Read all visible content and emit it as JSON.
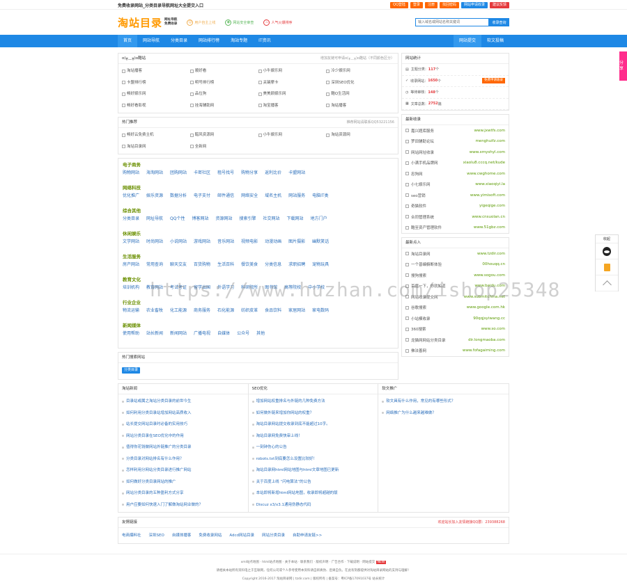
{
  "topbar": {
    "slogan": "免费收录网站_分类目录导航网址大全提交入口",
    "buttons": [
      "QQ登陆",
      "登录",
      "注册",
      "找回密码",
      "网站申请收录",
      "建议反馈"
    ]
  },
  "header": {
    "logo": "淘站目录",
    "logo_sub1": "网址导航",
    "logo_sub2": "免费收录",
    "features": [
      "用户自主上线",
      "网站安全审查",
      "人气火爆排序"
    ],
    "search_placeholder": "输入域名或网站名称关键词",
    "search_button": "收录查询"
  },
  "nav": {
    "items": [
      "首页",
      "网站导航",
      "分类目录",
      "网站排行榜",
      "淘站专题",
      "IT资讯"
    ],
    "right": [
      "网站提交",
      "软文投稿"
    ]
  },
  "recommend": {
    "title": "o(╥﹏╥)o酷站",
    "tip": "增加友链可申请o(╥﹏╥)o酷站（不同颜色区分）",
    "sites": [
      "淘站播客",
      "顺好看",
      "小牛娱乐网",
      "冷少娱乐网",
      "卡盟排行榜",
      "明号排行榜",
      "关键摩卡",
      "深圳SEO优化",
      "畅好娱乐网",
      "品位狗",
      "美美颜娱乐网",
      "酷Q生活网",
      "畅好看影视",
      "挂海辅助网",
      "淘宝播客",
      "淘站播客"
    ]
  },
  "hot": {
    "title": "热门推荐",
    "tip": "推荐网站请联系QQ53221156",
    "sites": [
      "畅好云免费主机",
      "醋风资源网",
      "小牛娱乐网",
      "淘站资源网",
      "淘站目录网",
      "全新网"
    ]
  },
  "categories": [
    {
      "name": "电子商务",
      "links": [
        "购物网站",
        "海淘网站",
        "团购网站",
        "卡密社区",
        "租号找号",
        "购物分享",
        "返利比价",
        "卡盟网站"
      ]
    },
    {
      "name": "网络科技",
      "links": [
        "优化推广",
        "娱乐资源",
        "数据分析",
        "电子支付",
        "邮件通信",
        "网络安全",
        "域名主机",
        "网站服务",
        "电脑IT类"
      ]
    },
    {
      "name": "综合其他",
      "links": [
        "分类目录",
        "网址导航",
        "QQ个性",
        "博客网站",
        "资源网站",
        "搜索引擎",
        "社交网站",
        "下载网站",
        "地方门户"
      ]
    },
    {
      "name": "休闲娱乐",
      "links": [
        "文学网站",
        "时尚网站",
        "小说网站",
        "游戏网站",
        "音乐网站",
        "视频电影",
        "动漫动画",
        "图片摄影",
        "幽默笑话"
      ]
    },
    {
      "name": "生活服务",
      "links": [
        "房产网站",
        "常用查询",
        "聊天交友",
        "百货购物",
        "生活百科",
        "餐饮美食",
        "分类信息",
        "求职招聘",
        "宠物玩具"
      ]
    },
    {
      "name": "教育文化",
      "links": [
        "培训机构",
        "教育网站",
        "考试考证",
        "留学出国",
        "外语学习",
        "科研院所",
        "图书馆",
        "高等院校",
        "中小学校"
      ]
    },
    {
      "name": "行业企业",
      "links": [
        "物流运输",
        "农业畜牧",
        "化工能源",
        "商务服务",
        "石化能源",
        "纺织皮革",
        "食品饮料",
        "家居网站",
        "家电数码"
      ]
    },
    {
      "name": "新闻媒体",
      "links": [
        "使用帮助",
        "站长新闻",
        "新闻网站",
        "广播电视",
        "自媒体",
        "公众号",
        "其他"
      ]
    }
  ],
  "hotsearch": {
    "title": "热门搜索网站",
    "tag": "分类目录"
  },
  "stats": {
    "title": "网站统计",
    "items": [
      {
        "label": "主题分类",
        "value": "117",
        "unit": "个"
      },
      {
        "label": "收录网站",
        "value": "1650",
        "unit": "个",
        "action": "免费申请收录"
      },
      {
        "label": "等待审核",
        "value": "148",
        "unit": "个"
      },
      {
        "label": "文章总数",
        "value": "2752",
        "unit": "篇"
      }
    ]
  },
  "latest": {
    "title": "最新收录",
    "items": [
      {
        "name": "嘉兴题库服务",
        "url": "www.jxwtfs.com"
      },
      {
        "name": "罗田辅助论坛",
        "url": "menghuifz.com"
      },
      {
        "name": "网站网址收录",
        "url": "www.xmyshyl.com"
      },
      {
        "name": "小满手机品牌网",
        "url": "xiaolu8.cccq.net/kude"
      },
      {
        "name": "忠狗网",
        "url": "www.cwghome.com"
      },
      {
        "name": "小七娱乐网",
        "url": "www.xiaoqiyi.la"
      },
      {
        "name": "seo营销",
        "url": "www.yimisoft.com"
      },
      {
        "name": "奇猫软件",
        "url": "yigeqige.com"
      },
      {
        "name": "合同管理系统",
        "url": "www.cnsuolan.cn"
      },
      {
        "name": "酷至资产管理软件",
        "url": "www.51gbz.com"
      }
    ]
  },
  "latestin": {
    "title": "最新点入",
    "items": [
      {
        "name": "淘站目录网",
        "url": "www.tzdir.com"
      },
      {
        "name": "一个普编橱断体验",
        "url": "00houqq.cn"
      },
      {
        "name": "搜狗搜索",
        "url": "www.sogou.com"
      },
      {
        "name": "百度一下，你就知道",
        "url": "www.baidu.com"
      },
      {
        "name": "网站收录提交网",
        "url": "www.submitchina.net"
      },
      {
        "name": "谷歌搜索",
        "url": "www.google.com.hk"
      },
      {
        "name": "小站模收录",
        "url": "90qqjsyiwang.cc"
      },
      {
        "name": "360搜索",
        "url": "www.so.com"
      },
      {
        "name": "龙猫网网站分类目录",
        "url": "dir.longmaoba.com"
      },
      {
        "name": "佛法善网",
        "url": "www.fofagaiming.com"
      }
    ]
  },
  "news": {
    "title": "淘站新闻",
    "items": [
      "目录站或属之淘站分类目录的前世今生",
      "如何利用分类目录站增加网站高质收入",
      "站长提交网站目录时必备的实用技巧",
      "网站分类目录在SEO优化中的作用",
      "值得你花钱做网站外链推广的分类目录",
      "分类目录对网站排名有什么作用？",
      "怎样利用分网站分类目录进行推广网站",
      "如何做好分类目录网站的推广",
      "网站分类目录的五种盈利方式分享",
      "用户应要如何快速入门了解做淘站网业做的？"
    ]
  },
  "seo": {
    "title": "SEO优化",
    "items": [
      "增加网站权重排名与外链的几种免费方法",
      "如何做外链来增加你网站的权重？",
      "淘站目录网站提交收录到底不能超过10字。",
      "淘站目录网免费快审上线！",
      "一刻钟伤心的公告",
      "robots.txt到底要怎么设置比较好！",
      "淘站目录网html网站地图与html文章地图已更新",
      "关于百度上线 “闪电算法”的公告",
      "本站即将新增html网站地图，收录即将超越的版",
      "Discuz x3/x3.1通用伪静态代码"
    ]
  },
  "softad": {
    "title": "软文推广",
    "items": [
      "软文具有什么作用，常见的有哪些形式？",
      "网络推广为什么越来越难做？"
    ]
  },
  "links": {
    "title": "友情链接",
    "tip": "欢迎站长加入友情链接QQ群：239388268",
    "items": [
      "电商爆料社",
      "深圳SEO",
      "自媒体播客",
      "免费收录网站",
      "Adcd网站目录",
      "网站分类目录",
      "自助申请友链>>"
    ]
  },
  "footer": {
    "line1": "xml站点地图 · html站点地图 · 关于本站 · 联系我们 · 版权声明 · 广告合作 · 下载说明 · 网站提交",
    "new_badge": "NEW",
    "line2": "请相关本站所有资料电之于互联网，任何公司或个人参考使用本资料请自辨真伪、后果自负。在此有刻都提供对淘站目录网站的支持与理解！",
    "line3": "Copyright 2016-2017 淘站目录网 | tzdir.com | 版权所有 | 备案号：粤ICP备17091037号 站长统计"
  },
  "side": {
    "share": "分享",
    "dock_title": "收起"
  },
  "watermark": "https://www.huzhan.com/ishop25348"
}
